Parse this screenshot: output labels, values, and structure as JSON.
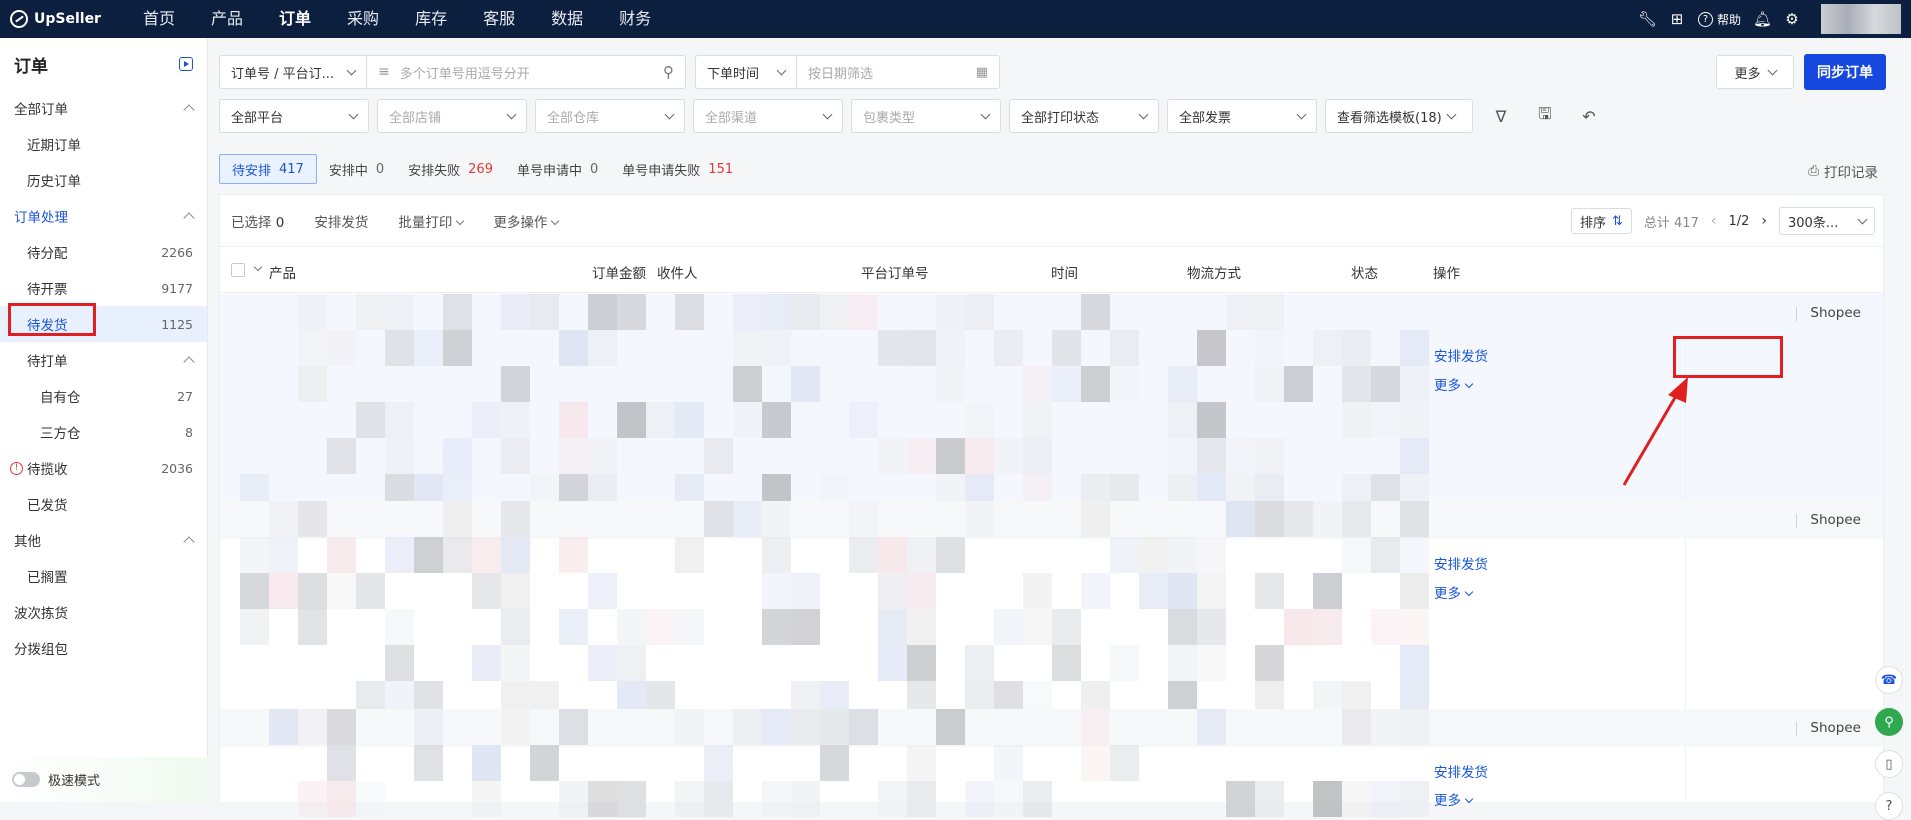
{
  "brand": {
    "name": "UpSeller"
  },
  "nav": [
    "首页",
    "产品",
    "订单",
    "采购",
    "库存",
    "客服",
    "数据",
    "财务"
  ],
  "nav_active": "订单",
  "top_right": {
    "help": "帮助"
  },
  "sidebar": {
    "title": "订单",
    "groups": [
      {
        "label": "全部订单",
        "items": [
          {
            "label": "近期订单"
          },
          {
            "label": "历史订单"
          }
        ]
      },
      {
        "label": "订单处理",
        "items": [
          {
            "label": "待分配",
            "count": "2266"
          },
          {
            "label": "待开票",
            "count": "9177"
          },
          {
            "label": "待发货",
            "count": "1125"
          },
          {
            "label": "待打单"
          },
          {
            "label": "自有仓",
            "count": "27"
          },
          {
            "label": "三方仓",
            "count": "8"
          },
          {
            "label": "待揽收",
            "count": "2036"
          },
          {
            "label": "已发货"
          }
        ]
      },
      {
        "label": "其他",
        "items": [
          {
            "label": "已搁置"
          }
        ]
      },
      {
        "label": "波次拣货"
      },
      {
        "label": "分拨组包"
      }
    ],
    "speed_mode": "极速模式"
  },
  "filters": {
    "order_type": "订单号 / 平台订...",
    "search_placeholder": "多个订单号用逗号分开",
    "time_type": "下单时间",
    "date_placeholder": "按日期筛选",
    "more": "更多",
    "sync": "同步订单",
    "platform": "全部平台",
    "shop": "全部店铺",
    "warehouse": "全部仓库",
    "channel": "全部渠道",
    "package": "包裹类型",
    "print_status": "全部打印状态",
    "invoice": "全部发票",
    "templates": "查看筛选模板(18)"
  },
  "tabs": [
    {
      "label": "待安排",
      "num": "417"
    },
    {
      "label": "安排中",
      "num": "0"
    },
    {
      "label": "安排失败",
      "num": "269"
    },
    {
      "label": "单号申请中",
      "num": "0"
    },
    {
      "label": "单号申请失败",
      "num": "151"
    }
  ],
  "print_log": "打印记录",
  "toolbar": {
    "selected_label": "已选择",
    "selected_num": "0",
    "arrange": "安排发货",
    "batch_print": "批量打印",
    "more_ops": "更多操作",
    "sort": "排序",
    "total": "总计 417",
    "page": "1/2",
    "page_size": "300条..."
  },
  "columns": [
    "产品",
    "订单金额",
    "收件人",
    "平台订单号",
    "时间",
    "物流方式",
    "状态",
    "操作"
  ],
  "orders": [
    {
      "platform": "Shopee",
      "action": "安排发货",
      "more": "更多"
    },
    {
      "platform": "Shopee",
      "action": "安排发货",
      "more": "更多"
    },
    {
      "platform": "Shopee",
      "action": "安排发货",
      "more": "更多"
    }
  ],
  "colors": {
    "primary": "#1648e0",
    "highlight": "#e02020",
    "nav_bg": "#0c1f3e"
  }
}
